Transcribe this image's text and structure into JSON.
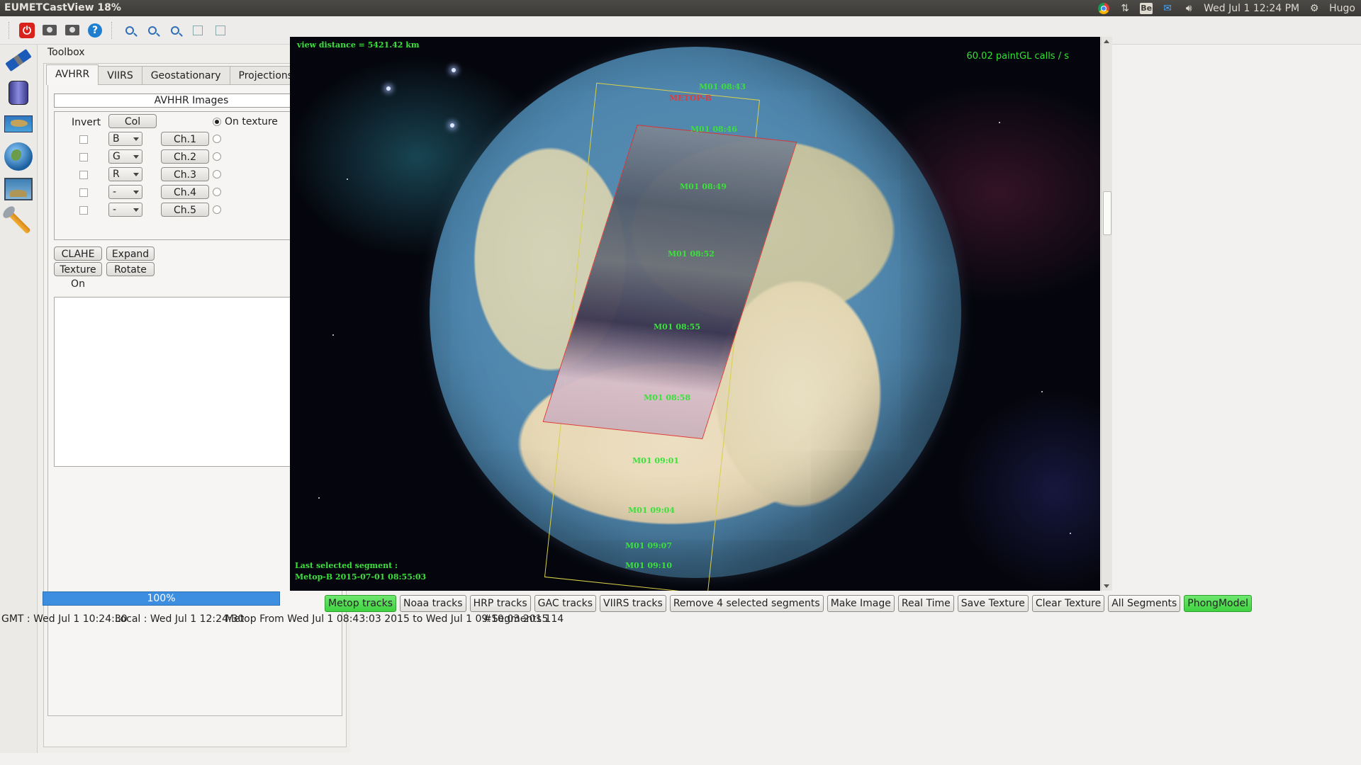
{
  "topbar": {
    "app_title": "EUMETCastView 18%",
    "clock": "Wed Jul  1 12:24 PM",
    "user": "Hugo",
    "indicator_icons": [
      "chrome-icon",
      "network-arrows-icon",
      "be-icon",
      "mail-icon",
      "volume-icon",
      "gear-icon"
    ]
  },
  "toolbar": {
    "icons": [
      "power-icon",
      "camera-icon",
      "screenshot-icon",
      "help-icon",
      "zoom-icon",
      "zoom-in-icon",
      "zoom-out-icon",
      "frame-icon",
      "frame-icon"
    ]
  },
  "sidebar": {
    "icons": [
      "satellite-icon",
      "cylinder-icon",
      "flat-map-icon",
      "globe-icon",
      "picture-icon",
      "wrench-icon"
    ]
  },
  "toolbox": {
    "title": "Toolbox",
    "tabs": [
      "AVHRR",
      "VIIRS",
      "Geostationary",
      "Projections"
    ],
    "active_tab": "AVHRR",
    "section_header": "AVHHR Images",
    "invert_label": "Invert",
    "col_button": "Col",
    "on_texture_label": "On texture",
    "channels": [
      {
        "color": "B",
        "button": "Ch.1"
      },
      {
        "color": "G",
        "button": "Ch.2"
      },
      {
        "color": "R",
        "button": "Ch.3"
      },
      {
        "color": "-",
        "button": "Ch.4"
      },
      {
        "color": "-",
        "button": "Ch.5"
      }
    ],
    "buttons": {
      "clahe": "CLAHE",
      "expand": "Expand",
      "texture_on": "Texture On",
      "rotate": "Rotate"
    },
    "progress_text": "100%",
    "progress_value": 1.0
  },
  "view": {
    "distance": "view distance =  5421.42 km",
    "fps": "60.02 paintGL calls / s",
    "satellite_label": "METOP-B",
    "segment_labels": [
      "M01 08:43",
      "M01 08:46",
      "M01 08:49",
      "M01 08:52",
      "M01 08:55",
      "M01 08:58",
      "M01 09:01",
      "M01 09:04",
      "M01 09:07",
      "M01 09:10"
    ],
    "last_selected_title": "Last selected segment :",
    "last_selected_value": "Metop-B 2015-07-01 08:55:03"
  },
  "bottom_buttons": [
    {
      "label": "Metop tracks",
      "active": true
    },
    {
      "label": "Noaa tracks",
      "active": false
    },
    {
      "label": "HRP tracks",
      "active": false
    },
    {
      "label": "GAC tracks",
      "active": false
    },
    {
      "label": "VIIRS tracks",
      "active": false
    },
    {
      "label": "Remove 4 selected segments",
      "active": false
    },
    {
      "label": "Make Image",
      "active": false
    },
    {
      "label": "Real Time",
      "active": false
    },
    {
      "label": "Save Texture",
      "active": false
    },
    {
      "label": "Clear Texture",
      "active": false
    },
    {
      "label": "All Segments",
      "active": false
    },
    {
      "label": "PhongModel",
      "active": true
    }
  ],
  "statusbar": {
    "gmt": "GMT : Wed Jul  1 10:24:30",
    "local": "Local : Wed Jul  1 12:24:30",
    "metop": "Metop From Wed Jul 1 08:43:03 2015 to Wed Jul 1 09:10:03 2015",
    "segments": "#Segments 114"
  },
  "colors": {
    "accent_green": "#3fd23f",
    "progress_blue": "#3d8ee0",
    "overlay_green": "#3be03b",
    "track_yellow": "#d8d04a",
    "segment_red": "#dd3333"
  }
}
